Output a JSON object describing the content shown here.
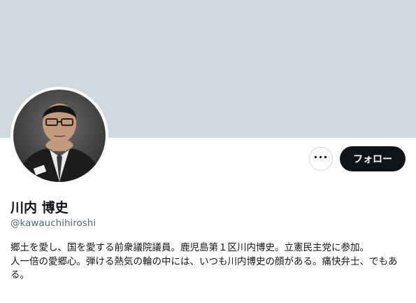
{
  "profile": {
    "display_name": "川内 博史",
    "handle": "@kawauchihiroshi",
    "bio_lines": [
      "郷土を愛し、国を愛する前衆議院議員。鹿児島第１区川内博史。立憲民主党に参加。",
      "人一倍の愛郷心。弾ける熱気の輪の中には、いつも川内博史の顔がある。痛快弁士、でもある。"
    ]
  },
  "actions": {
    "more_label": "···",
    "follow_label": "フォロー"
  },
  "colors": {
    "banner": "#cfd9de",
    "follow_bg": "#0f1419",
    "handle_text": "#536471"
  }
}
